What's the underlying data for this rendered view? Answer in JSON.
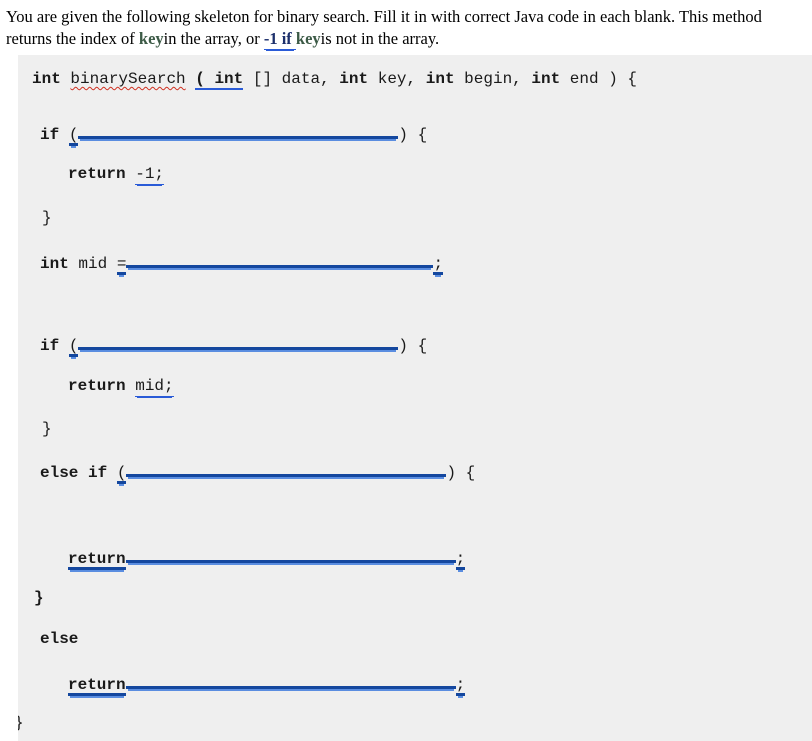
{
  "prompt": {
    "part1": "You are given the following skeleton for binary search. Fill it in with correct Java code in each blank. This method returns the index of ",
    "key1": "key",
    "part2": "in the array, or ",
    "minus_one": "-1 if ",
    "key2": "key",
    "part3": "is not in the array."
  },
  "code": {
    "signature": {
      "ret_type": "int",
      "method_name": "binarySearch",
      "paren_int": "( int",
      "brackets": "[] data,",
      "p2_type": "int",
      "p2_name": "key,",
      "p3_type": "int",
      "p3_name": "begin,",
      "p4_type": "int",
      "p4_name": "end ) {"
    },
    "if1": {
      "keyword": "if",
      "open_paren": "(",
      "close": ") {"
    },
    "return_minus1": {
      "keyword": "return",
      "value": "-1;"
    },
    "close_brace_1": "}",
    "mid_decl": {
      "type": "int",
      "name": "mid",
      "equals": "=",
      "semicolon": ";"
    },
    "if2": {
      "keyword": "if",
      "open_paren": "(",
      "close": ") {"
    },
    "return_mid": {
      "keyword": "return",
      "value": "mid;"
    },
    "close_brace_2": "}",
    "else_if": {
      "keyword": "else if",
      "open_paren": "(",
      "close": ") {"
    },
    "return_blank_1": {
      "keyword": "return",
      "semicolon": ";"
    },
    "close_brace_3": "}",
    "else_kw": "else",
    "return_blank_2": {
      "keyword": "return",
      "semicolon": ";"
    },
    "close_brace_final": "}"
  },
  "colors": {
    "code_background": "#efefef",
    "blank_rule": "#14479e",
    "blank_rule_light": "#5a8de0",
    "grammar_underline": "#2a5bd7",
    "spellcheck_underline": "#d03020",
    "keyword_green": "#3c5a46",
    "keyword_blue": "#1c2f6b",
    "page_background": "#ffffff"
  }
}
